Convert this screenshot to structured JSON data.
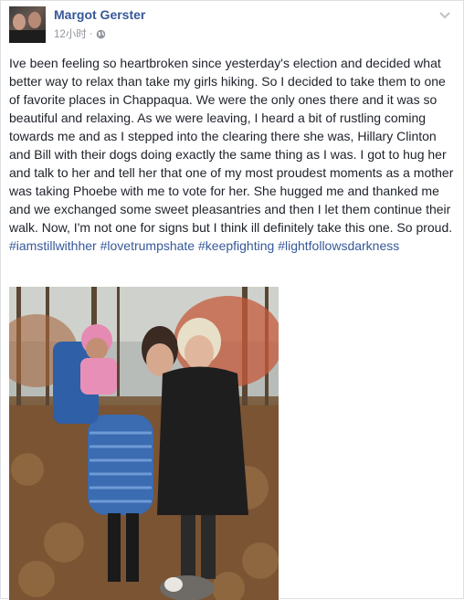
{
  "post": {
    "author": "Margot Gerster",
    "time": "12小时",
    "separator": "·",
    "privacy_icon": "globe-icon",
    "menu_icon": "chevron-down-icon",
    "text": "Ive been feeling so heartbroken since yesterday's election and decided what better way to relax than take my girls hiking. So I decided to take them to one of favorite places in Chappaqua. We were the only ones there and it was so beautiful and relaxing. As we were leaving, I heard a bit of rustling coming towards me and as I stepped into the clearing there she was, Hillary Clinton and Bill with their dogs doing exactly the same thing as I was. I got to hug her and talk to her and tell her that one of my most proudest moments as a mother was taking Phoebe with me to vote for her. She hugged me and thanked me and we exchanged some sweet pleasantries and then I let them continue their walk. Now, I'm not one for signs but I think ill definitely take this one. So proud.",
    "hashtags": [
      "#iamstillwithher",
      "#lovetrumpshate",
      "#keepfighting",
      "#lightfollowsdarkness"
    ],
    "colors": {
      "link": "#365899",
      "text": "#1d2129",
      "meta": "#90949c"
    }
  }
}
